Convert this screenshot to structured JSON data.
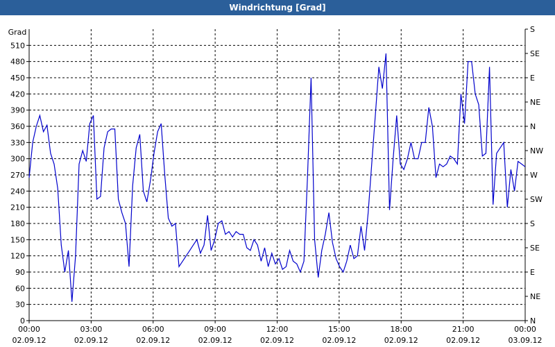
{
  "window": {
    "title": "Windrichtung [Grad]"
  },
  "chart_data": {
    "type": "line",
    "title": "Windrichtung [Grad]",
    "ylabel": "Grad",
    "ylim": [
      0,
      540
    ],
    "y_ticks": [
      0,
      30,
      60,
      90,
      120,
      150,
      180,
      210,
      240,
      270,
      300,
      330,
      360,
      390,
      420,
      450,
      480,
      510
    ],
    "right_axis_labels": [
      "N",
      "NE",
      "E",
      "SE",
      "S",
      "SW",
      "W",
      "NW",
      "N",
      "NE",
      "E",
      "SE",
      "S"
    ],
    "x_ticks": [
      {
        "time": "00:00",
        "date": "02.09.12"
      },
      {
        "time": "03:00",
        "date": "02.09.12"
      },
      {
        "time": "06:00",
        "date": "02.09.12"
      },
      {
        "time": "09:00",
        "date": "02.09.12"
      },
      {
        "time": "12:00",
        "date": "02.09.12"
      },
      {
        "time": "15:00",
        "date": "02.09.12"
      },
      {
        "time": "18:00",
        "date": "02.09.12"
      },
      {
        "time": "21:00",
        "date": "02.09.12"
      },
      {
        "time": "00:00",
        "date": "03.09.12"
      }
    ],
    "grid": true,
    "line_color": "#0000cc",
    "series": [
      {
        "x_hours": [
          0,
          0.1,
          0.2,
          0.3,
          0.4,
          0.5,
          0.6,
          0.7,
          0.8,
          0.9,
          1.0,
          1.1,
          1.2,
          1.3,
          1.4,
          1.5,
          1.6,
          1.7,
          1.8,
          1.9,
          2.0,
          2.1,
          2.2,
          2.3,
          2.4,
          2.5,
          2.6,
          2.7,
          2.8,
          2.9,
          3.0,
          3.1,
          3.2,
          3.3,
          3.4,
          3.5,
          3.6,
          3.7,
          3.8,
          3.9,
          4.0,
          4.1,
          4.2,
          4.3,
          4.4,
          4.5,
          4.6,
          4.7,
          4.8,
          4.9,
          5.0,
          5.1,
          5.2,
          5.3,
          5.4,
          5.5,
          5.6,
          5.7,
          5.8,
          5.9,
          6.0,
          6.1,
          6.2,
          6.3,
          6.4,
          6.5,
          6.6,
          6.7,
          6.8,
          6.9,
          7.0,
          7.2,
          7.4,
          7.6,
          7.8,
          8.0,
          8.2,
          8.4,
          8.6,
          8.8,
          9.0,
          9.2,
          9.4,
          9.6,
          9.8,
          10.0,
          10.2,
          10.4,
          10.6,
          10.8,
          11.0,
          11.2,
          11.4,
          11.6,
          11.8,
          12.0,
          12.2,
          12.4,
          12.6,
          12.8,
          13.0,
          13.2,
          13.4,
          13.6,
          13.8,
          14.0,
          14.2,
          14.4,
          14.6,
          14.8,
          15.0,
          15.2,
          15.4,
          15.6,
          15.8,
          16.0,
          16.2,
          16.4,
          16.6,
          16.8,
          17.0,
          17.2,
          17.4,
          17.6,
          17.8,
          18.0,
          18.2,
          18.4,
          18.6,
          18.8,
          19.0,
          19.2,
          19.4,
          19.6,
          19.8,
          20.0,
          20.2,
          20.4,
          20.6,
          20.8,
          21.0,
          21.2,
          21.4,
          21.6,
          21.8,
          22.0,
          22.2,
          22.4,
          22.6,
          22.8,
          23.0,
          23.2,
          23.4,
          23.6,
          23.8,
          24.0
        ],
        "values": [
          265,
          330,
          360,
          380,
          350,
          362,
          310,
          290,
          245,
          140,
          90,
          130,
          35,
          120,
          290,
          315,
          295,
          365,
          380,
          225,
          230,
          320,
          350,
          355,
          355,
          225,
          200,
          180,
          100,
          250,
          320,
          345,
          240,
          220,
          260,
          310,
          350,
          365,
          270,
          190,
          175,
          180,
          100,
          110,
          120,
          130,
          140,
          150,
          125,
          140,
          195,
          130,
          150,
          180,
          185,
          160,
          165,
          155,
          165,
          160,
          160,
          135,
          130,
          150,
          140,
          110,
          135,
          100,
          125,
          105,
          115,
          95,
          100,
          130,
          110,
          105,
          90,
          110,
          265,
          450,
          150,
          80,
          130,
          160,
          200,
          145,
          115,
          100,
          90,
          110,
          140,
          115,
          120,
          175,
          130,
          200,
          290,
          380,
          470,
          430,
          495,
          205,
          300,
          380,
          290,
          280,
          300,
          330,
          300,
          300,
          330,
          330,
          395,
          360,
          265,
          290,
          285,
          290,
          305,
          300,
          290,
          420,
          365,
          480,
          480,
          420,
          400,
          305,
          310,
          470,
          215,
          310,
          320,
          330,
          210,
          280,
          240,
          295,
          290,
          285
        ],
        "values_fixed_length": true
      }
    ]
  }
}
